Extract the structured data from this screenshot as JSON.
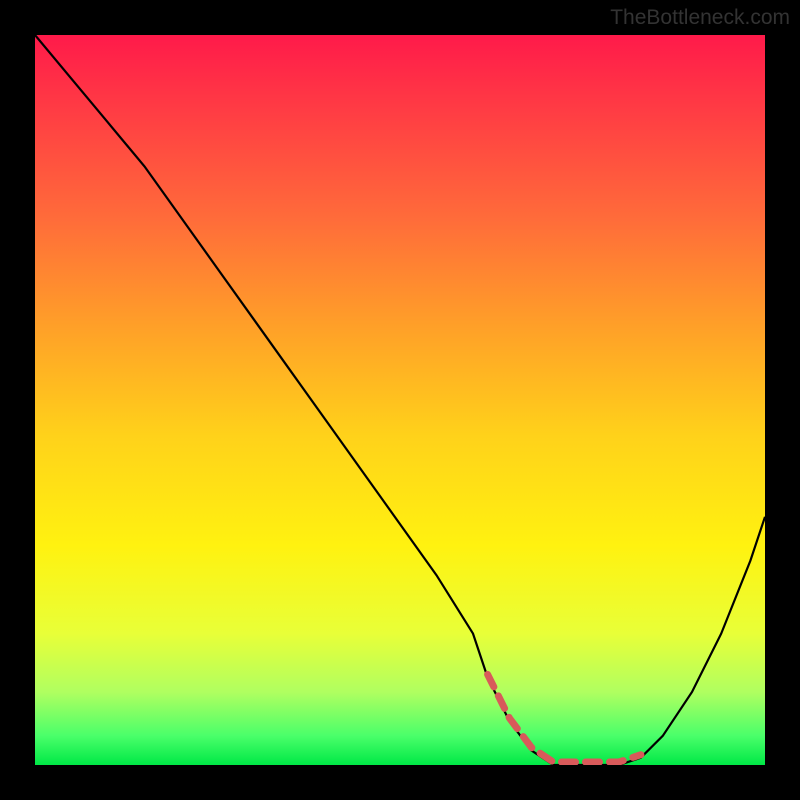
{
  "watermark": "TheBottleneck.com",
  "chart_data": {
    "type": "line",
    "title": "",
    "xlabel": "",
    "ylabel": "",
    "xlim": [
      0,
      100
    ],
    "ylim": [
      0,
      100
    ],
    "series": [
      {
        "name": "bottleneck_curve",
        "x": [
          0,
          5,
          10,
          15,
          20,
          25,
          30,
          35,
          40,
          45,
          50,
          55,
          60,
          62,
          65,
          68,
          71,
          74,
          77,
          80,
          83,
          86,
          90,
          94,
          98,
          100
        ],
        "y": [
          100,
          94,
          88,
          82,
          75,
          68,
          61,
          54,
          47,
          40,
          33,
          26,
          18,
          12,
          6,
          2,
          0,
          0,
          0,
          0,
          1,
          4,
          10,
          18,
          28,
          34
        ]
      }
    ],
    "gradient_stops": [
      {
        "pos": 0.0,
        "color": "#ff1a4a"
      },
      {
        "pos": 0.1,
        "color": "#ff3b44"
      },
      {
        "pos": 0.25,
        "color": "#ff6b3a"
      },
      {
        "pos": 0.4,
        "color": "#ffa028"
      },
      {
        "pos": 0.55,
        "color": "#ffd21a"
      },
      {
        "pos": 0.7,
        "color": "#fff210"
      },
      {
        "pos": 0.82,
        "color": "#e8ff38"
      },
      {
        "pos": 0.9,
        "color": "#b0ff60"
      },
      {
        "pos": 0.96,
        "color": "#4aff6a"
      },
      {
        "pos": 1.0,
        "color": "#00e846"
      }
    ],
    "highlight_range": {
      "x_start": 62,
      "x_end": 83,
      "color": "#e06060"
    }
  }
}
